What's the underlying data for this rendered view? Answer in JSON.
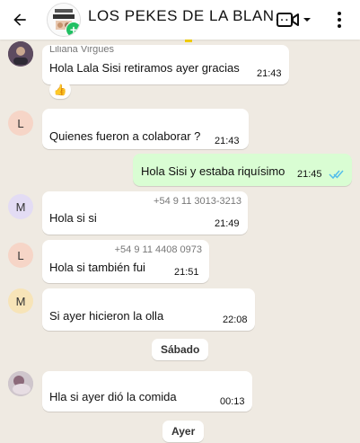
{
  "header": {
    "title": "LOS PEKES DE LA BLAN…",
    "icons": [
      "back-arrow-icon",
      "video-call-icon",
      "chevron-down-icon",
      "more-vert-icon"
    ]
  },
  "messages": [
    {
      "sender": "Liliana Virgues",
      "text": "Hola Lala Sisi retiramos ayer gracias",
      "time": "21:43",
      "reaction": "👍"
    },
    {
      "avatar": "L",
      "text": "Quienes fueron a colaborar ?",
      "time": "21:43"
    },
    {
      "text": "Hola Sisi y estaba riquísimo",
      "time": "21:45",
      "outgoing": true
    },
    {
      "avatar": "M",
      "sender": "+54 9 11 3013-3213",
      "text": "Hola si si",
      "time": "21:49"
    },
    {
      "avatar": "L",
      "sender": "+54 9 11 4408 0973",
      "text": "Hola si también fui",
      "time": "21:51"
    },
    {
      "avatar": "M",
      "text": "Si ayer hicieron la olla",
      "time": "22:08"
    },
    {
      "text": "Hla si ayer dió la comida",
      "time": "00:13"
    }
  ],
  "dates": {
    "first": "Sábado",
    "second": "Ayer"
  },
  "colors": {
    "chat_bg": "#efeae2",
    "outgoing_bubble": "#d9fdd3",
    "read_ticks": "#53bdeb",
    "avatar_L": "#f6d5c7",
    "avatar_M": "#e3dcf4",
    "avatar_M2": "#f7e4b8"
  }
}
